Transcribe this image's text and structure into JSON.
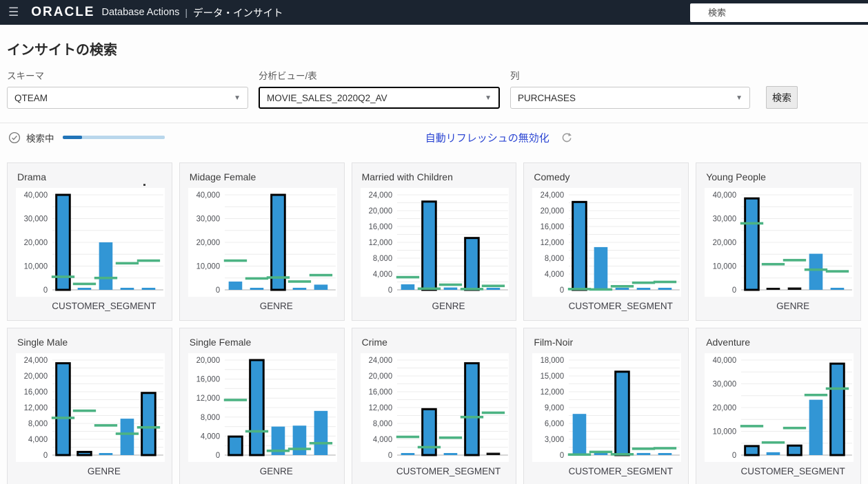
{
  "header": {
    "logo": "ORACLE",
    "app_name": "Database Actions",
    "separator": "|",
    "page_title": "データ・インサイト",
    "search_placeholder": "検索"
  },
  "main": {
    "heading": "インサイトの検索",
    "filters": {
      "schema_label": "スキーマ",
      "schema_value": "QTEAM",
      "analytic_view_label": "分析ビュー/表",
      "analytic_view_value": "MOVIE_SALES_2020Q2_AV",
      "column_label": "列",
      "column_value": "PURCHASES",
      "search_button_label": "検索",
      "chevron": "▼"
    },
    "status": {
      "text": "検索中",
      "progress_percent": 19,
      "auto_refresh_link": "自動リフレッシュの無効化"
    }
  },
  "colors": {
    "bar_blue": "#3296d5",
    "expected_green": "#4cb383",
    "emphasis_black": "#111111",
    "grid_line": "#ececec",
    "axis_line": "#c9c9c9",
    "tick_text": "#4d4f55"
  },
  "chart_data": [
    {
      "type": "bar",
      "title": "Drama",
      "xlabel": "CUSTOMER_SEGMENT",
      "ymax": 40000,
      "tick_step": 10000,
      "has_dot": true,
      "values": [
        40000,
        800,
        20000,
        800,
        800
      ],
      "expected": [
        5500,
        2500,
        5000,
        11200,
        12300
      ],
      "emphasis": [
        "outlined",
        "plain",
        "plain",
        "plain",
        "plain"
      ]
    },
    {
      "type": "bar",
      "title": "Midage Female",
      "xlabel": "GENRE",
      "ymax": 40000,
      "tick_step": 10000,
      "values": [
        3500,
        600,
        40000,
        300,
        2200
      ],
      "expected": [
        12300,
        4800,
        5200,
        3500,
        6200
      ],
      "emphasis": [
        "plain",
        "plain",
        "outlined",
        "plain",
        "plain"
      ]
    },
    {
      "type": "bar",
      "title": "Married with Children",
      "xlabel": "GENRE",
      "ymax": 24000,
      "tick_step": 4000,
      "values": [
        1400,
        22300,
        600,
        13100,
        300
      ],
      "expected": [
        3200,
        300,
        1300,
        200,
        1000
      ],
      "emphasis": [
        "plain",
        "outlined",
        "plain",
        "outlined",
        "plain"
      ]
    },
    {
      "type": "bar",
      "title": "Comedy",
      "xlabel": "CUSTOMER_SEGMENT",
      "ymax": 24000,
      "tick_step": 4000,
      "values": [
        22200,
        10800,
        500,
        400,
        200
      ],
      "expected": [
        200,
        100,
        900,
        1800,
        2000
      ],
      "emphasis": [
        "outlined",
        "plain",
        "plain",
        "plain",
        "plain"
      ]
    },
    {
      "type": "bar",
      "title": "Young People",
      "xlabel": "GENRE",
      "ymax": 40000,
      "tick_step": 10000,
      "values": [
        38500,
        800,
        1000,
        15200,
        500
      ],
      "expected": [
        28000,
        10800,
        12500,
        8500,
        7800
      ],
      "emphasis": [
        "outlined",
        "black",
        "black",
        "plain",
        "plain"
      ]
    },
    {
      "type": "bar",
      "title": "Single Male",
      "xlabel": "GENRE",
      "ymax": 24000,
      "tick_step": 4000,
      "values": [
        23200,
        800,
        300,
        9200,
        15700
      ],
      "expected": [
        9400,
        11200,
        7500,
        5400,
        7000
      ],
      "emphasis": [
        "outlined",
        "outlined",
        "plain",
        "plain",
        "outlined"
      ]
    },
    {
      "type": "bar",
      "title": "Single Female",
      "xlabel": "GENRE",
      "ymax": 20000,
      "tick_step": 4000,
      "values": [
        3900,
        20000,
        6000,
        6200,
        9300
      ],
      "expected": [
        11600,
        5000,
        900,
        1300,
        2500
      ],
      "emphasis": [
        "outlined",
        "outlined",
        "plain",
        "plain",
        "plain"
      ]
    },
    {
      "type": "bar",
      "title": "Crime",
      "xlabel": "CUSTOMER_SEGMENT",
      "ymax": 24000,
      "tick_step": 4000,
      "values": [
        400,
        11600,
        300,
        23200,
        600
      ],
      "expected": [
        4600,
        2000,
        4400,
        9600,
        10700
      ],
      "emphasis": [
        "plain",
        "outlined",
        "plain",
        "outlined",
        "black"
      ]
    },
    {
      "type": "bar",
      "title": "Film-Noir",
      "xlabel": "CUSTOMER_SEGMENT",
      "ymax": 18000,
      "tick_step": 3000,
      "values": [
        7800,
        300,
        15800,
        400,
        250
      ],
      "expected": [
        100,
        600,
        150,
        1200,
        1300
      ],
      "emphasis": [
        "plain",
        "plain",
        "outlined",
        "plain",
        "plain"
      ]
    },
    {
      "type": "bar",
      "title": "Adventure",
      "xlabel": "CUSTOMER_SEGMENT",
      "ymax": 40000,
      "tick_step": 10000,
      "values": [
        3800,
        1200,
        4000,
        23300,
        38500
      ],
      "expected": [
        12200,
        5300,
        11400,
        25300,
        28000
      ],
      "emphasis": [
        "outlined",
        "plain",
        "outlined",
        "plain",
        "outlined"
      ]
    }
  ]
}
